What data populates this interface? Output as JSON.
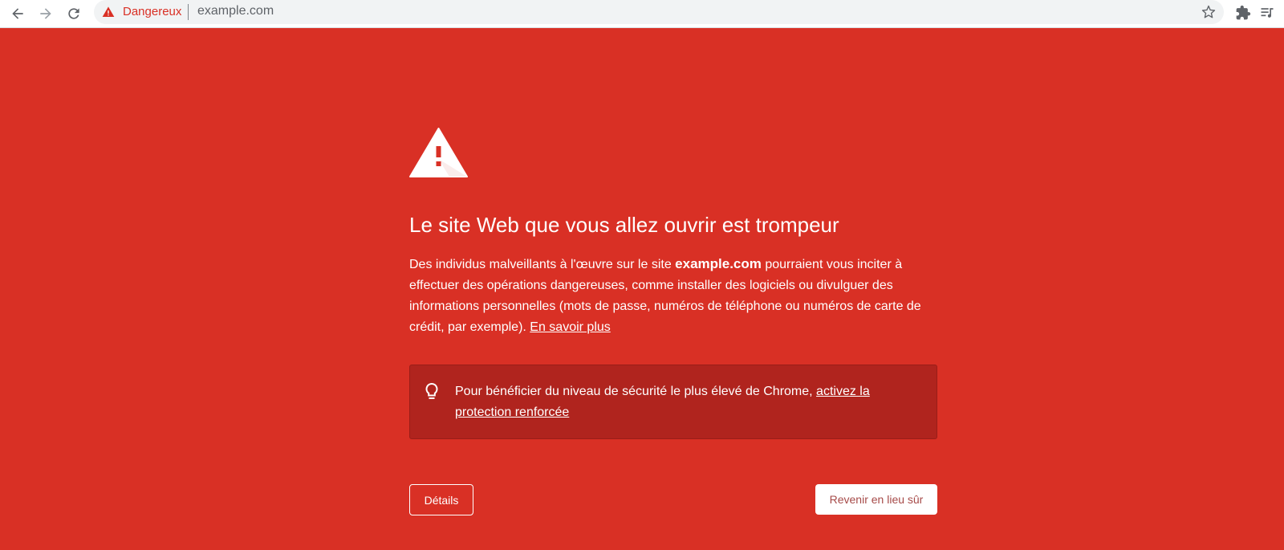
{
  "toolbar": {
    "back_icon": "arrow-left-icon",
    "forward_icon": "arrow-right-icon",
    "reload_icon": "reload-icon",
    "security_label": "Dangereux",
    "url": "example.com",
    "star_icon": "star-icon",
    "extensions_icon": "puzzle-icon",
    "media_icon": "media-queue-icon"
  },
  "interstitial": {
    "headline": "Le site Web que vous allez ouvrir est trompeur",
    "body_before": "Des individus malveillants à l'œuvre sur le site ",
    "domain": "example.com",
    "body_after": " pourraient vous inciter à effectuer des opérations dangereuses, comme installer des logiciels ou divulguer des informations personnelles (mots de passe, numéros de téléphone ou numéros de carte de crédit, par exemple). ",
    "learn_more": "En savoir plus",
    "tip_text": "Pour bénéficier du niveau de sécurité le plus élevé de Chrome, ",
    "tip_link": "activez la protection renforcée",
    "details_button": "Détails",
    "back_button": "Revenir en lieu sûr"
  },
  "colors": {
    "background": "#d93025",
    "tip_box": "#b0241e",
    "back_button_text": "#a64a48"
  }
}
